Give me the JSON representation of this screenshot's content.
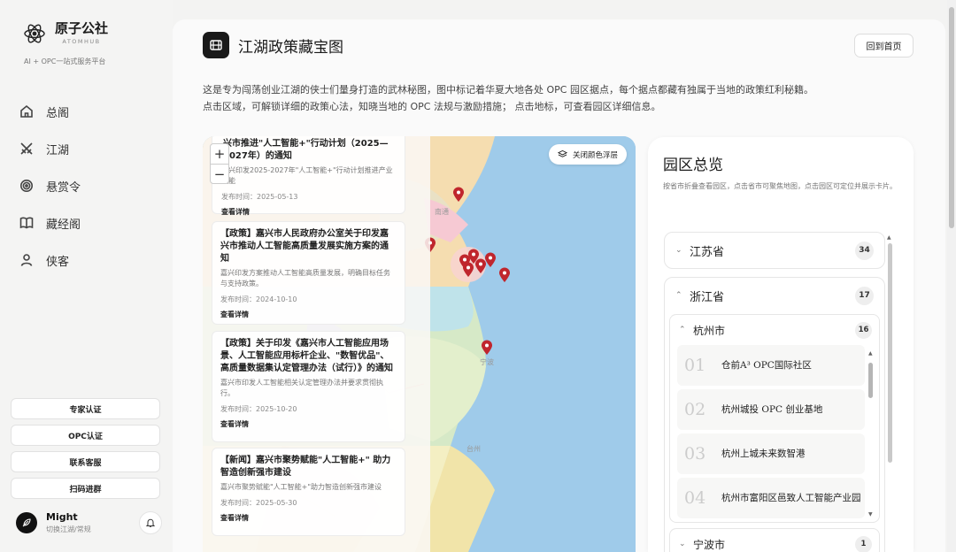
{
  "brand": {
    "name": "原子公社",
    "sub": "ATOMHUB",
    "tagline": "AI + OPC一站式服务平台"
  },
  "nav": [
    {
      "label": "总阁",
      "icon": "home-icon"
    },
    {
      "label": "江湖",
      "icon": "swords-icon"
    },
    {
      "label": "悬赏令",
      "icon": "target-icon"
    },
    {
      "label": "藏经阁",
      "icon": "book-icon"
    },
    {
      "label": "侠客",
      "icon": "user-icon"
    }
  ],
  "side_buttons": [
    "专家认证",
    "OPC认证",
    "联系客服",
    "扫码进群"
  ],
  "user": {
    "name": "Might",
    "sub": "切换江湖/常规"
  },
  "header": {
    "title": "江湖政策藏宝图",
    "home_button": "回到首页"
  },
  "intro": {
    "line1": "这是专为闯荡创业江湖的侠士们量身打造的武林秘图，图中标记着华夏大地各处 OPC 园区据点，每个据点都藏有独属于当地的政策红利秘籍。",
    "line2": "点击区域，可解锁详细的政策心法，知晓当地的 OPC 法规与激励措施； 点击地标，可查看园区详细信息。"
  },
  "map": {
    "toggle_layer": "关闭颜色浮层",
    "zoom_in": "+",
    "zoom_out": "−",
    "labels": [
      "南通",
      "宁波",
      "台州"
    ]
  },
  "policies": [
    {
      "title": "兴市推进\"人工智能+\"行动计划（2025—2027年）的通知",
      "desc": "嘉兴印发2025-2027年\"人工智能+\"行动计划推进产业赋能",
      "date": "发布时间：2025-05-13",
      "link": "查看详情"
    },
    {
      "title": "【政策】嘉兴市人民政府办公室关于印发嘉兴市推动人工智能高质量发展实施方案的通知",
      "desc": "嘉兴印发方案推动人工智能高质量发展，明确目标任务与支持政策。",
      "date": "发布时间：2024-10-10",
      "link": "查看详情"
    },
    {
      "title": "【政策】关于印发《嘉兴市人工智能应用场景、人工智能应用标杆企业、\"数智优品\"、高质量数据集认定管理办法（试行）》的通知",
      "desc": "嘉兴市印发人工智能相关认定管理办法并要求贯彻执行。",
      "date": "发布时间：2025-10-20",
      "link": "查看详情"
    },
    {
      "title": "【新闻】嘉兴市聚势赋能\"人工智能+\" 助力智造创新强市建设",
      "desc": "嘉兴市聚势赋能\"人工智能+\"助力智造创新强市建设",
      "date": "发布时间：2025-05-30",
      "link": "查看详情"
    }
  ],
  "overview": {
    "title": "园区总览",
    "desc": "按省市折叠查看园区，点击省市可聚焦地图，点击园区可定位并展示卡片。",
    "provinces": [
      {
        "name": "江苏省",
        "count": "34"
      },
      {
        "name": "浙江省",
        "count": "17"
      }
    ],
    "cities": [
      {
        "name": "杭州市",
        "count": "16"
      },
      {
        "name": "宁波市",
        "count": "1"
      }
    ],
    "parks": [
      {
        "no": "01",
        "name": "仓前A³ OPC国际社区"
      },
      {
        "no": "02",
        "name": "杭州城投 OPC 创业基地"
      },
      {
        "no": "03",
        "name": "杭州上城未来数智港"
      },
      {
        "no": "04",
        "name": "杭州市富阳区邑致人工智能产业园"
      }
    ]
  },
  "colors": {
    "accent": "#1a1a1a",
    "pin": "#c0262d",
    "sea": "#9fcbea"
  }
}
